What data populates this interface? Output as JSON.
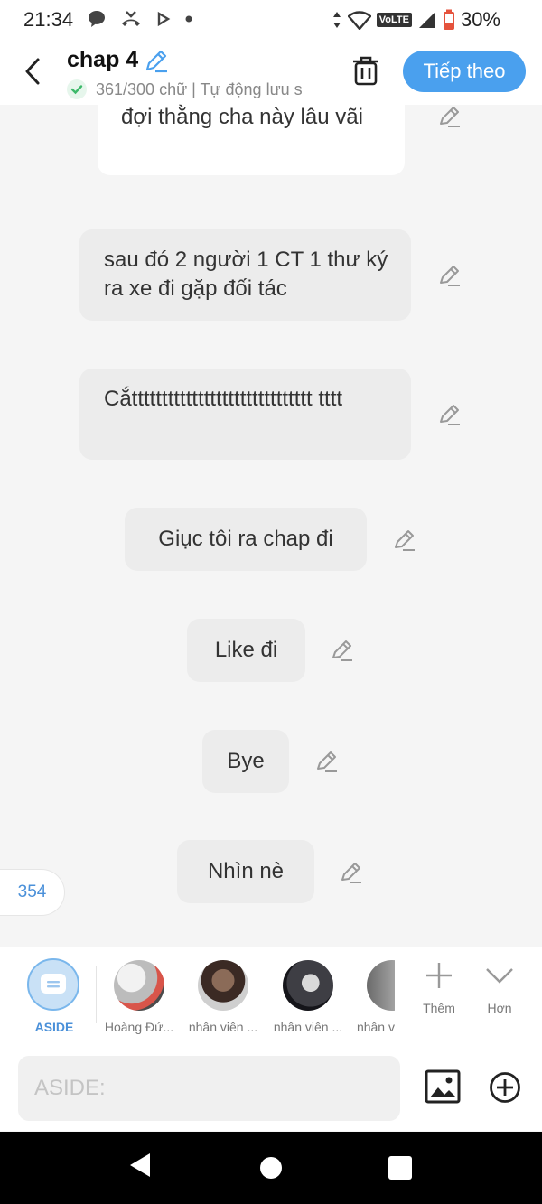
{
  "status_bar": {
    "time": "21:34",
    "network_badge": "VoLTE",
    "battery_text": "30%",
    "left_icons": [
      "message-icon",
      "missed-call-icon",
      "play-icon",
      "dot-icon"
    ],
    "right_icons": [
      "data-arrows-icon",
      "wifi-icon",
      "signal-icon",
      "battery-icon"
    ]
  },
  "header": {
    "title": "chap 4",
    "subtitle": "361/300 chữ | Tự động lưu s",
    "next_button": "Tiếp theo",
    "accent_color": "#4aa0ee"
  },
  "messages": [
    {
      "text": "đợi thằng cha này lâu vãi"
    },
    {
      "text": "sau đó 2 người 1 CT 1 thư ký ra xe đi gặp đối tác"
    },
    {
      "text": "Cắtttttttttttttttttttttttttttttt tttt"
    },
    {
      "text": "Giục tôi ra chap đi"
    },
    {
      "text": "Like đi"
    },
    {
      "text": "Bye"
    },
    {
      "text": "Nhìn nè"
    }
  ],
  "counter": "354",
  "characters": [
    {
      "label": "ASIDE"
    },
    {
      "label": "Hoàng Đứ..."
    },
    {
      "label": "nhân viên ..."
    },
    {
      "label": "nhân viên ..."
    },
    {
      "label": "nhân v"
    }
  ],
  "tools": {
    "add_label": "Thêm",
    "more_label": "Hơn"
  },
  "input": {
    "placeholder": "ASIDE:"
  }
}
